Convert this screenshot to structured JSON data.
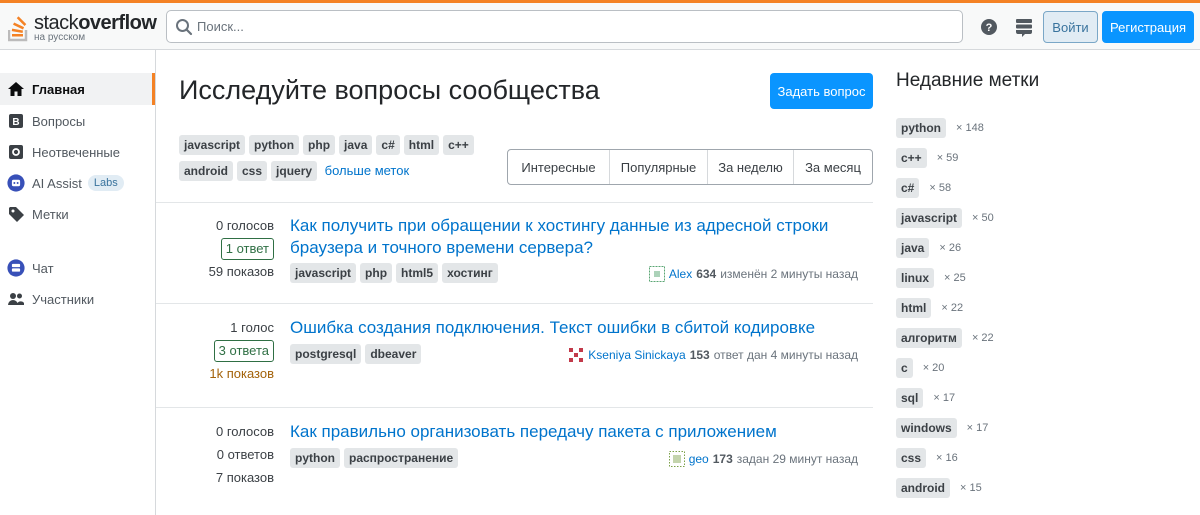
{
  "header": {
    "logo_word_light": "stack",
    "logo_word_bold": "overflow",
    "logo_sub": "на русском",
    "search_placeholder": "Поиск...",
    "login": "Войти",
    "signup": "Регистрация"
  },
  "nav": {
    "items": [
      {
        "label": "Главная",
        "icon": "home-icon"
      },
      {
        "label": "Вопросы",
        "icon": "questions-icon"
      },
      {
        "label": "Неотвеченные",
        "icon": "unanswered-icon"
      },
      {
        "label": "AI Assist",
        "icon": "ai-assist-icon",
        "badge": "Labs"
      },
      {
        "label": "Метки",
        "icon": "tag-icon"
      },
      {
        "label": "Чат",
        "icon": "chat-icon"
      },
      {
        "label": "Участники",
        "icon": "users-icon"
      }
    ]
  },
  "main": {
    "title": "Исследуйте вопросы сообщества",
    "ask_button": "Задать вопрос",
    "tags_row1": [
      "javascript",
      "python",
      "php",
      "java",
      "c#",
      "html",
      "c++"
    ],
    "tags_row2": [
      "android",
      "css",
      "jquery"
    ],
    "more_tags": "больше меток",
    "tabs": [
      "Интересные",
      "Популярные",
      "За неделю",
      "За месяц"
    ]
  },
  "questions": [
    {
      "votes": "0 голосов",
      "answers": "1 ответ",
      "views": "59 показов",
      "title": "Как получить при обращении к хостингу данные из адресной строки браузера и точного времени сервера?",
      "tags": [
        "javascript",
        "php",
        "html5",
        "хостинг"
      ],
      "user": "Alex",
      "rep": "634",
      "action": "изменён 2 минуты назад"
    },
    {
      "votes": "1 голос",
      "answers": "3 ответа",
      "views": "1k показов",
      "title": "Ошибка создания подключения. Текст ошибки в сбитой кодировке",
      "tags": [
        "postgresql",
        "dbeaver"
      ],
      "user": "Kseniya Sinickaya",
      "rep": "153",
      "action": "ответ дан 4 минуты назад"
    },
    {
      "votes": "0 голосов",
      "answers": "0 ответов",
      "views": "7 показов",
      "title": "Как правильно организовать передачу пакета с приложением",
      "tags": [
        "python",
        "распространение"
      ],
      "user": "geo",
      "rep": "173",
      "action": "задан 29 минут назад"
    }
  ],
  "recent_tags": {
    "title": "Недавние метки",
    "items": [
      {
        "name": "python",
        "count": "× 148"
      },
      {
        "name": "c++",
        "count": "× 59"
      },
      {
        "name": "c#",
        "count": "× 58"
      },
      {
        "name": "javascript",
        "count": "× 50"
      },
      {
        "name": "java",
        "count": "× 26"
      },
      {
        "name": "linux",
        "count": "× 25"
      },
      {
        "name": "html",
        "count": "× 22"
      },
      {
        "name": "алгоритм",
        "count": "× 22"
      },
      {
        "name": "c",
        "count": "× 20"
      },
      {
        "name": "sql",
        "count": "× 17"
      },
      {
        "name": "windows",
        "count": "× 17"
      },
      {
        "name": "css",
        "count": "× 16"
      },
      {
        "name": "android",
        "count": "× 15"
      }
    ]
  },
  "colors": {
    "accent": "#f48225",
    "link": "#0074cc",
    "primary_button": "#0a95ff",
    "answered": "#2f6f44",
    "hot_views": "#a3620a"
  }
}
